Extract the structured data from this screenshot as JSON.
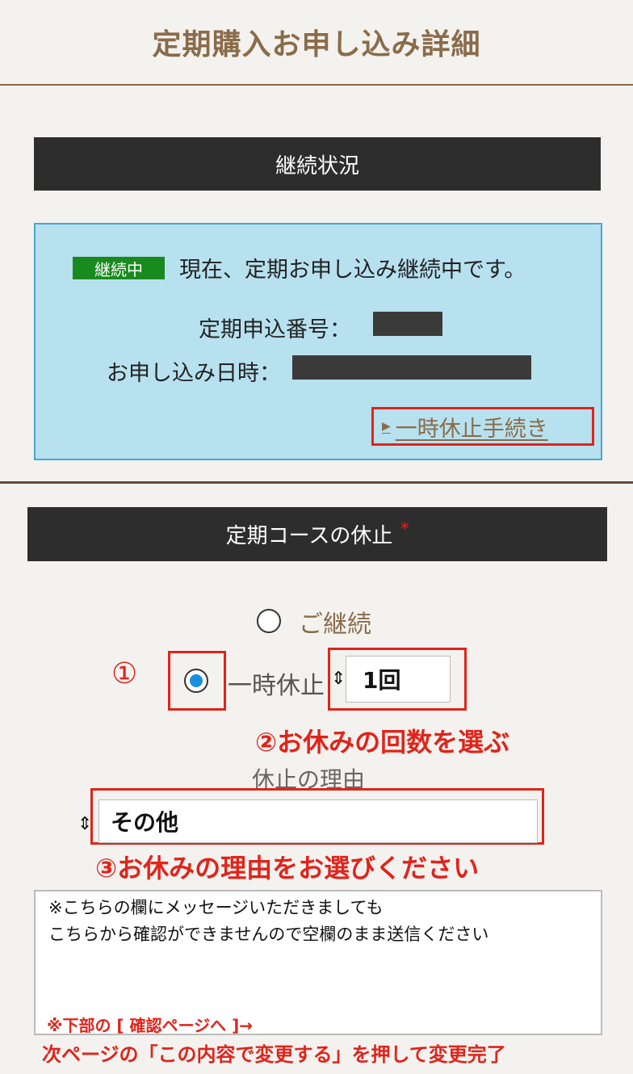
{
  "header": {
    "title": "定期購入お申し込み詳細"
  },
  "status_section": {
    "title": "継続状況",
    "badge": "継続中",
    "message": "現在、定期お申し込み継続中です。",
    "number_label": "定期申込番号：",
    "date_label": "お申し込み日時：",
    "pause_link": "一時休止手続き"
  },
  "pause_section": {
    "title": "定期コースの休止",
    "required_mark": "*",
    "option_continue": "ご継続",
    "option_pause": "一時休止",
    "count_value": "1回",
    "reason_label": "休止の理由",
    "reason_value": "その他"
  },
  "annotations": {
    "step1": "①",
    "step2": "②お休みの回数を選ぶ",
    "step3": "③お休みの理由をお選びください"
  },
  "memo": {
    "line1": "※こちらの欄にメッセージいただきましても",
    "line2": "こちらから確認ができませんので空欄のまま送信ください",
    "note1": "※下部の [ 確認ページへ ]→",
    "note2": "次ページの「この内容で変更する」を押して変更完了"
  },
  "colors": {
    "brand": "#8a6c4a",
    "highlight": "#e0241b",
    "badge": "#198a1e",
    "status_bg": "#b7e1ef"
  }
}
